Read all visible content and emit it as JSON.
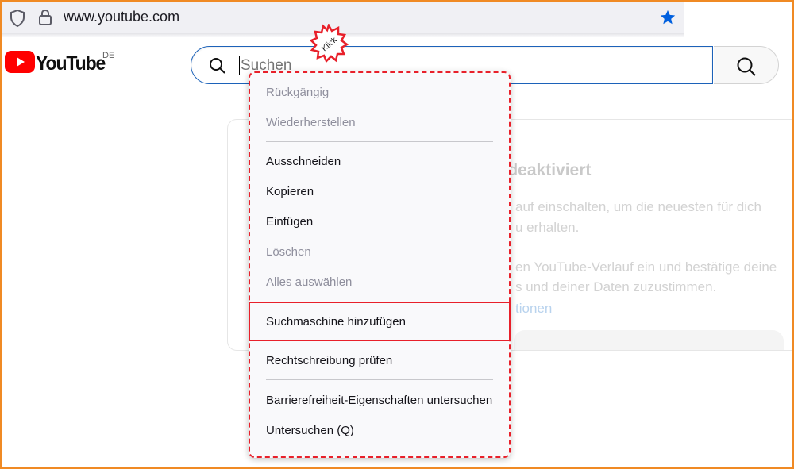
{
  "browser": {
    "url": "www.youtube.com",
    "colors": {
      "star": "#0060df",
      "frame": "#f08a24"
    }
  },
  "youtube": {
    "logo_text": "YouTube",
    "region": "DE",
    "search": {
      "placeholder": "Suchen"
    }
  },
  "annotation": {
    "badge": "Klick"
  },
  "background_card": {
    "title_fragment": "ist deaktiviert",
    "lines": [
      "auf einschalten, um die neuesten für dich",
      "u erhalten.",
      "en YouTube-Verlauf ein und bestätige deine",
      "s und deiner Daten zuzustimmen.",
      "tionen"
    ]
  },
  "context_menu": {
    "items": [
      {
        "label": "Rückgängig",
        "enabled": false
      },
      {
        "label": "Wiederherstellen",
        "enabled": false
      },
      {
        "label": "Ausschneiden",
        "enabled": true
      },
      {
        "label": "Kopieren",
        "enabled": true
      },
      {
        "label": "Einfügen",
        "enabled": true
      },
      {
        "label": "Löschen",
        "enabled": false
      },
      {
        "label": "Alles auswählen",
        "enabled": false
      },
      {
        "label": "Suchmaschine hinzufügen",
        "enabled": true,
        "highlighted": true
      },
      {
        "label": "Rechtschreibung prüfen",
        "enabled": true
      },
      {
        "label": "Barrierefreiheit-Eigenschaften untersuchen",
        "enabled": true
      },
      {
        "label": "Untersuchen (Q)",
        "enabled": true
      }
    ],
    "highlight_color": "#e8202a"
  }
}
